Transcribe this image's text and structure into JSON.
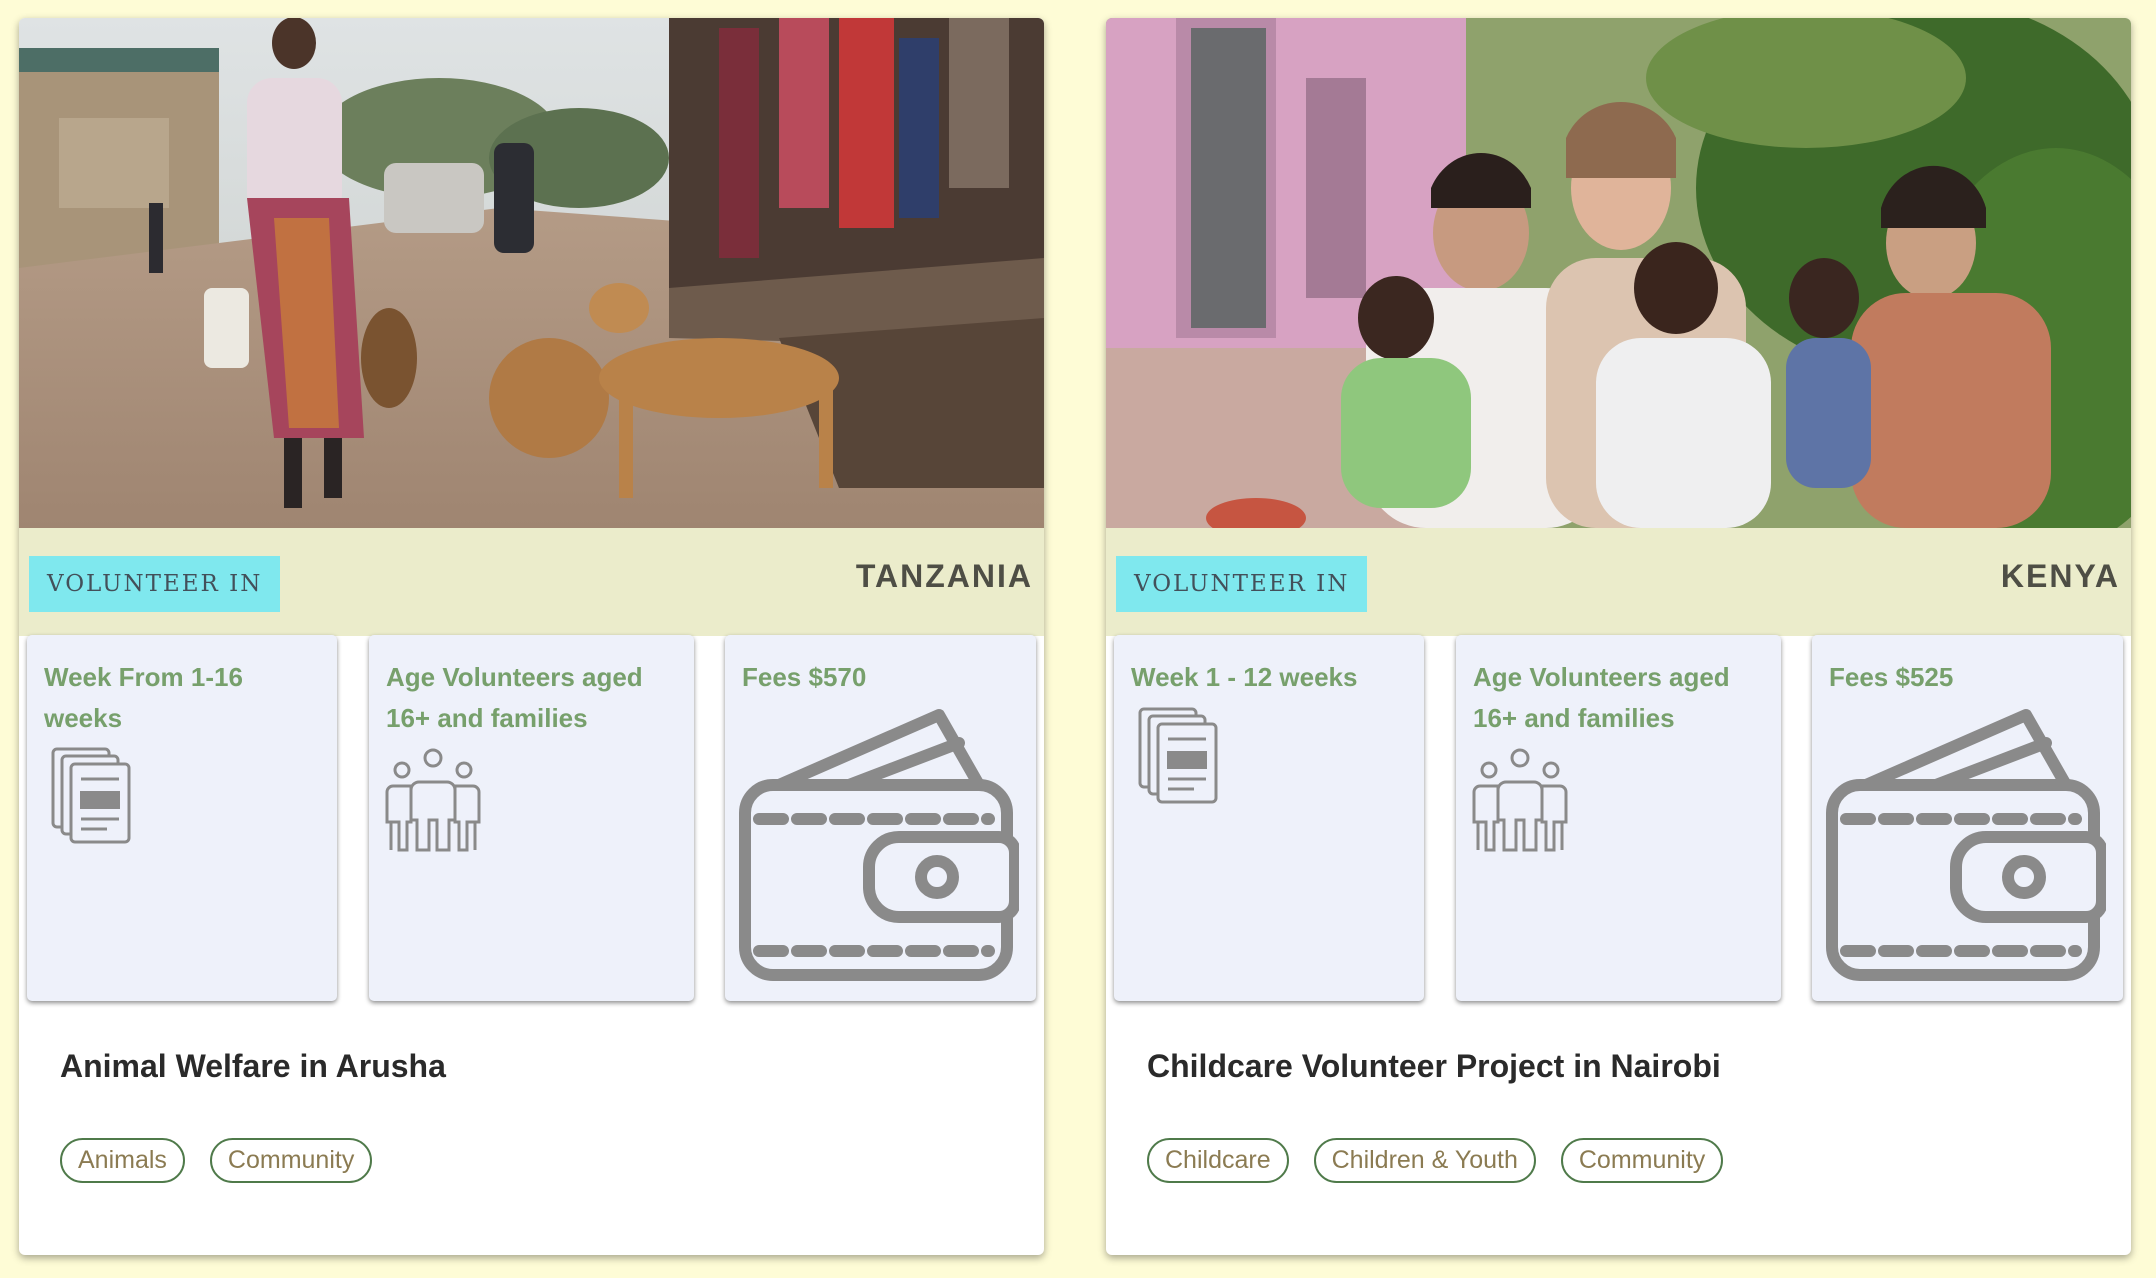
{
  "cards": [
    {
      "photo_alt": "Woman walking on a dirt road with stray dogs",
      "volunteer_label": "VOLUNTEER IN",
      "country": "TANZANIA",
      "duration": "Week From 1-16 weeks",
      "age": "Age Volunteers aged 16+ and families",
      "fees": "Fees $570",
      "title": "Animal Welfare in Arusha",
      "tags": [
        "Animals",
        "Community"
      ]
    },
    {
      "photo_alt": "Three women holding small children",
      "volunteer_label": "VOLUNTEER IN",
      "country": "KENYA",
      "duration": "Week 1 - 12 weeks",
      "age": "Age Volunteers aged 16+ and families",
      "fees": "Fees $525",
      "title": "Childcare Volunteer Project in Nairobi",
      "tags": [
        "Childcare",
        "Children & Youth",
        "Community"
      ]
    }
  ],
  "icons": {
    "duration": "document-stack-icon",
    "age": "family-group-icon",
    "fees": "wallet-icon"
  },
  "colors": {
    "page_background": "#fefcd6",
    "volunteer_tag": "#7fe8ee",
    "info_label": "#77a06c",
    "tag_border": "#4f7a4a"
  }
}
